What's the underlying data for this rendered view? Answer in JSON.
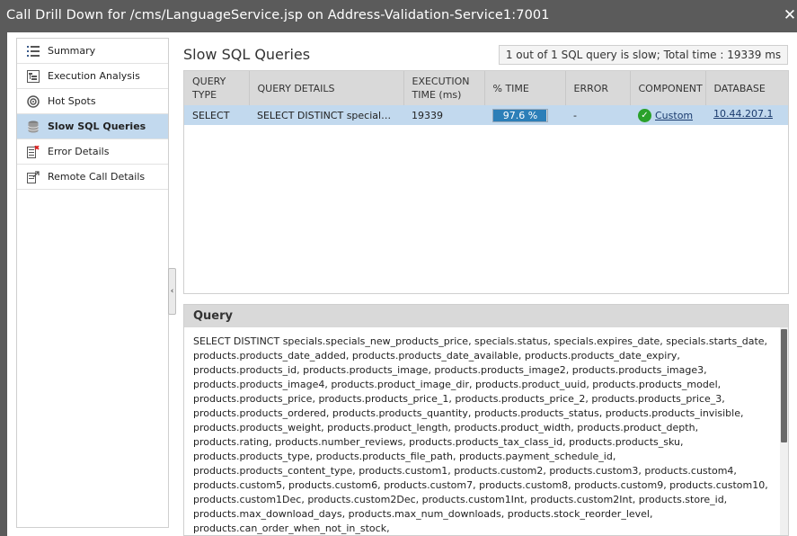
{
  "window": {
    "title": "Call Drill Down for /cms/LanguageService.jsp on Address-Validation-Service1:7001",
    "close_glyph": "✕"
  },
  "nav": {
    "items": [
      {
        "label": "Summary",
        "icon": "list-icon",
        "active": false
      },
      {
        "label": "Execution Analysis",
        "icon": "tree-icon",
        "active": false
      },
      {
        "label": "Hot Spots",
        "icon": "target-icon",
        "active": false
      },
      {
        "label": "Slow SQL Queries",
        "icon": "database-icon",
        "active": true
      },
      {
        "label": "Error Details",
        "icon": "error-doc-icon",
        "active": false
      },
      {
        "label": "Remote Call Details",
        "icon": "remote-call-icon",
        "active": false
      }
    ],
    "collapse_glyph": "‹"
  },
  "main": {
    "title": "Slow SQL Queries",
    "summary": "1 out of 1 SQL query is slow; Total time : 19339 ms"
  },
  "table": {
    "headers": {
      "query_type": "QUERY TYPE",
      "query_details": "QUERY DETAILS",
      "execution_time": "EXECUTION TIME (ms)",
      "pct_time": "% TIME",
      "error": "ERROR",
      "component": "COMPONENT",
      "database": "DATABASE"
    },
    "rows": [
      {
        "query_type": "SELECT",
        "query_details": "SELECT DISTINCT specials.specials_new_products_price",
        "execution_time": "19339",
        "pct_time_label": "97.6 %",
        "pct_time_value": 97.6,
        "error": "-",
        "component": "Custom",
        "database": "10.44.207.1"
      }
    ]
  },
  "query": {
    "title": "Query",
    "text": "SELECT DISTINCT specials.specials_new_products_price, specials.status, specials.expires_date, specials.starts_date, products.products_date_added, products.products_date_available, products.products_date_expiry, products.products_id, products.products_image, products.products_image2, products.products_image3, products.products_image4, products.product_image_dir, products.product_uuid, products.products_model, products.products_price, products.products_price_1, products.products_price_2, products.products_price_3, products.products_ordered, products.products_quantity, products.products_status, products.products_invisible, products.products_weight, products.product_length, products.product_width, products.product_depth, products.rating, products.number_reviews, products.products_tax_class_id, products.products_sku, products.products_type, products.products_file_path, products.payment_schedule_id, products.products_content_type, products.custom1, products.custom2, products.custom3, products.custom4, products.custom5, products.custom6, products.custom7, products.custom8, products.custom9, products.custom10, products.custom1Dec, products.custom2Dec, products.custom1Int, products.custom2Int, products.store_id, products.max_download_days, products.max_num_downloads, products.stock_reorder_level, products.can_order_when_not_in_stock,"
  }
}
